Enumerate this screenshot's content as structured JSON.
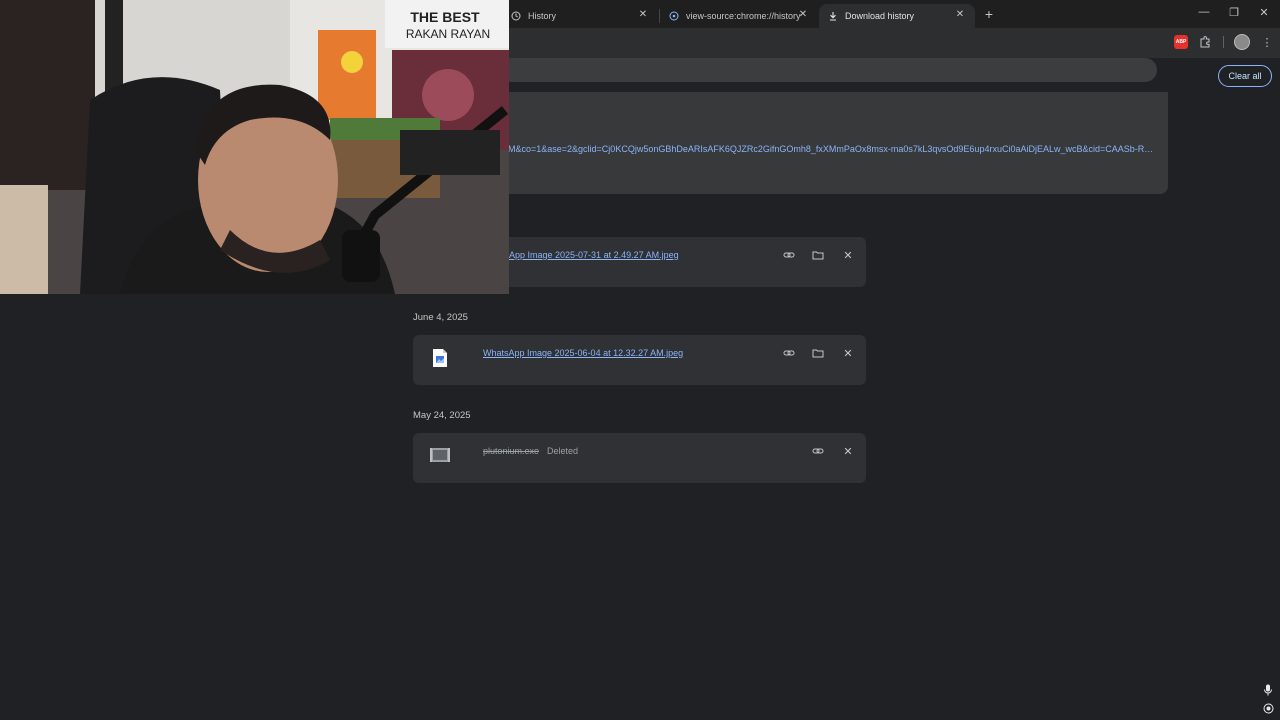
{
  "tabs": [
    {
      "label": "History",
      "icon": "history-icon"
    },
    {
      "label": "view-source:chrome://history",
      "icon": "globe-icon"
    },
    {
      "label": "Download history",
      "icon": "download-icon"
    }
  ],
  "header": {
    "clear_all_label": "Clear all"
  },
  "top_card": {
    "url": "M&co=1&ase=2&gclid=Cj0KCQjw5onGBhDeARIsAFK6QJZRc2GifnGOmh8_fxXMmPaOx8msx-ma0s7kL3qvsOd9E6up4rxuCi0aAiDjEALw_wcB&cid=CAASb-Ro..."
  },
  "groups": [
    {
      "date": "",
      "items": [
        {
          "name": "App Image 2025-07-31 at 2.49.27 AM.jpeg",
          "status": ""
        }
      ]
    },
    {
      "date": "June 4, 2025",
      "items": [
        {
          "name": "WhatsApp Image 2025-06-04 at 12.32.27 AM.jpeg",
          "status": ""
        }
      ]
    },
    {
      "date": "May 24, 2025",
      "items": [
        {
          "name": "plutonium.exe",
          "status": "Deleted"
        }
      ]
    }
  ],
  "webcam": {
    "poster_text_1": "THE BEST",
    "poster_text_2": "RAKAN RAYAN"
  },
  "colors": {
    "accent": "#8ab4f8",
    "background": "#202124",
    "card": "#303134",
    "abp": "#e5322d"
  }
}
